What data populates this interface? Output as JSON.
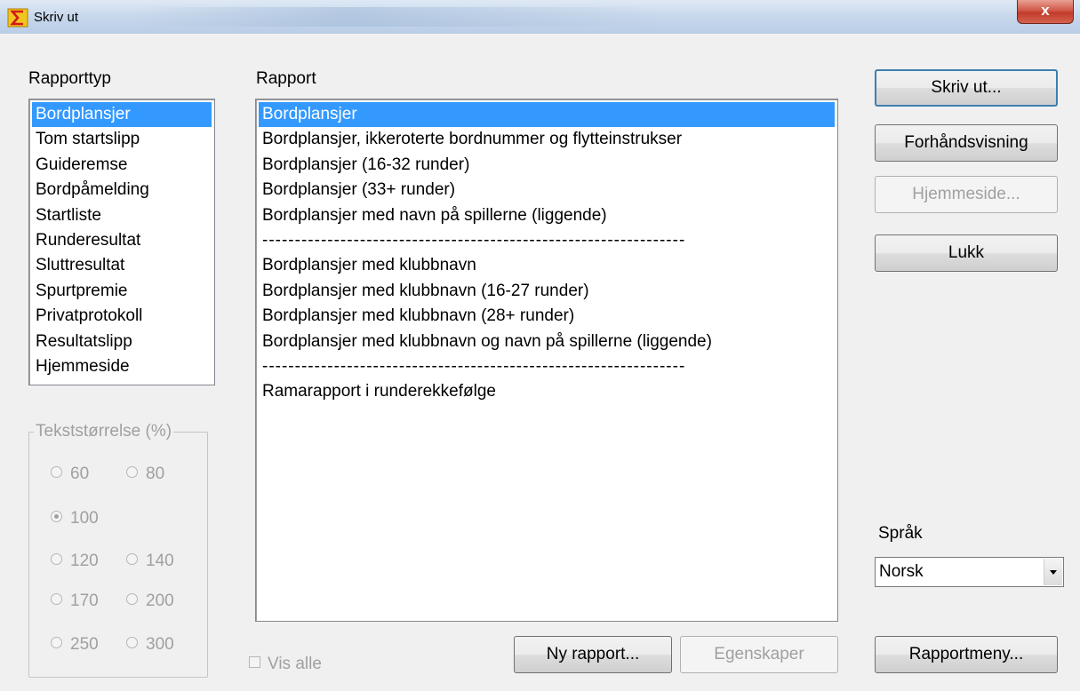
{
  "window": {
    "title": "Skriv ut",
    "close_label": "x"
  },
  "rapporttyp": {
    "label": "Rapporttyp",
    "items": [
      "Bordplansjer",
      "Tom startslipp",
      "Guideremse",
      "Bordpåmelding",
      "Startliste",
      "Runderesultat",
      "Sluttresultat",
      "Spurtpremie",
      "Privatprotokoll",
      "Resultatslipp",
      "Hjemmeside"
    ],
    "selected_index": 0
  },
  "rapport": {
    "label": "Rapport",
    "items": [
      "Bordplansjer",
      "Bordplansjer, ikkeroterte bordnummer og flytteinstrukser",
      "Bordplansjer (16-32 runder)",
      "Bordplansjer (33+ runder)",
      "Bordplansjer med navn på spillerne (liggende)",
      "-----------------------------------------------------------------",
      "Bordplansjer med klubbnavn",
      "Bordplansjer med klubbnavn (16-27 runder)",
      "Bordplansjer med klubbnavn (28+ runder)",
      "Bordplansjer med klubbnavn og navn på spillerne (liggende)",
      "-----------------------------------------------------------------",
      "Ramarapport i runderekkefølge"
    ],
    "selected_index": 0
  },
  "tekststorrelse": {
    "legend": "Tekststørrelse (%)",
    "options": [
      "60",
      "80",
      "100",
      "120",
      "140",
      "170",
      "200",
      "250",
      "300"
    ],
    "selected": "100"
  },
  "buttons": {
    "skriv_ut": "Skriv ut...",
    "forhandsvisning": "Forhåndsvisning",
    "hjemmeside": "Hjemmeside...",
    "lukk": "Lukk",
    "ny_rapport": "Ny rapport...",
    "egenskaper": "Egenskaper",
    "rapportmeny": "Rapportmeny..."
  },
  "vis_alle": {
    "label": "Vis alle",
    "checked": false
  },
  "sprak": {
    "label": "Språk",
    "value": "Norsk"
  },
  "colors": {
    "selection": "#3399ff",
    "disabled_text": "#a0a0a0",
    "title_bar": "#c9d9ec"
  }
}
